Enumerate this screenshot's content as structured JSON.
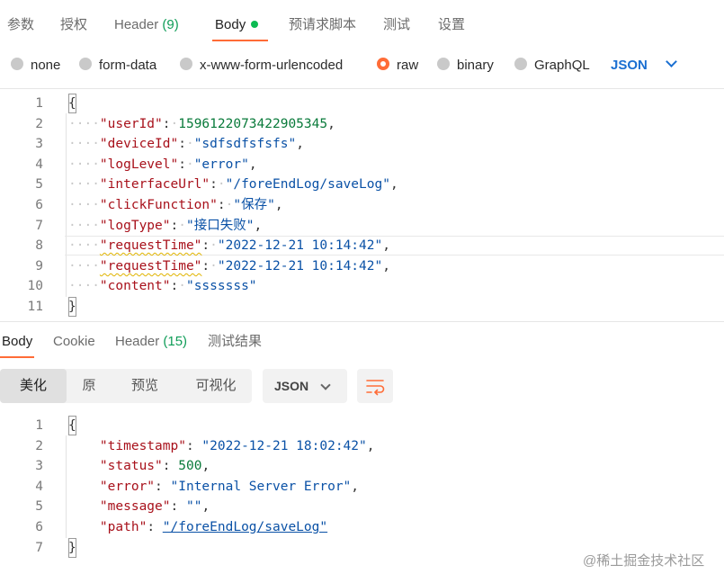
{
  "request_tabs": {
    "params": "参数",
    "auth": "授权",
    "headers_label": "Header",
    "headers_count": "(9)",
    "body": "Body",
    "prerequest": "预请求脚本",
    "tests": "测试",
    "settings": "设置"
  },
  "body_types": {
    "none": "none",
    "form_data": "form-data",
    "urlencoded": "x-www-form-urlencoded",
    "raw": "raw",
    "binary": "binary",
    "graphql": "GraphQL",
    "format": "JSON",
    "selected": "raw"
  },
  "request_body": {
    "line_numbers": [
      "1",
      "2",
      "3",
      "4",
      "5",
      "6",
      "7",
      "8",
      "9",
      "10",
      "11"
    ],
    "open": "{",
    "close": "}",
    "fields": [
      {
        "key": "\"userId\"",
        "value": "1596122073422905345",
        "comma": ","
      },
      {
        "key": "\"deviceId\"",
        "value": "\"sdfsdfsfsfs\"",
        "comma": ","
      },
      {
        "key": "\"logLevel\"",
        "value": "\"error\"",
        "comma": ","
      },
      {
        "key": "\"interfaceUrl\"",
        "value": "\"/foreEndLog/saveLog\"",
        "comma": ","
      },
      {
        "key": "\"clickFunction\"",
        "value": "\"保存\"",
        "comma": ","
      },
      {
        "key": "\"logType\"",
        "value": "\"接口失败\"",
        "comma": ","
      },
      {
        "key": "\"requestTime\"",
        "value": "\"2022-12-21 10:14:42\"",
        "comma": ","
      },
      {
        "key": "\"requestTime\"",
        "value": "\"2022-12-21 10:14:42\"",
        "comma": ","
      },
      {
        "key": "\"content\"",
        "value": "\"sssssss\"",
        "comma": ""
      }
    ]
  },
  "response_tabs": {
    "body": "Body",
    "cookie": "Cookie",
    "headers_label": "Header",
    "headers_count": "(15)",
    "test_results": "测试结果"
  },
  "view_toolbar": {
    "pretty": "美化",
    "raw": "原",
    "preview": "预览",
    "visualize": "可视化",
    "format": "JSON"
  },
  "response_body": {
    "line_numbers": [
      "1",
      "2",
      "3",
      "4",
      "5",
      "6",
      "7"
    ],
    "open": "{",
    "close": "}",
    "fields": [
      {
        "key": "\"timestamp\"",
        "value": "\"2022-12-21 18:02:42\"",
        "comma": ","
      },
      {
        "key": "\"status\"",
        "value": "500",
        "comma": ","
      },
      {
        "key": "\"error\"",
        "value": "\"Internal Server Error\"",
        "comma": ","
      },
      {
        "key": "\"message\"",
        "value": "\"\"",
        "comma": ","
      },
      {
        "key": "\"path\"",
        "value": "\"/foreEndLog/saveLog\"",
        "comma": ""
      }
    ]
  },
  "watermark": "@稀土掘金技术社区",
  "colors": {
    "accent": "#ff6c37",
    "link_blue": "#1a6fd1",
    "status_green": "#0f9d58",
    "key_red": "#a8111b",
    "string_blue": "#0a51a6",
    "number_green": "#097a3a"
  }
}
